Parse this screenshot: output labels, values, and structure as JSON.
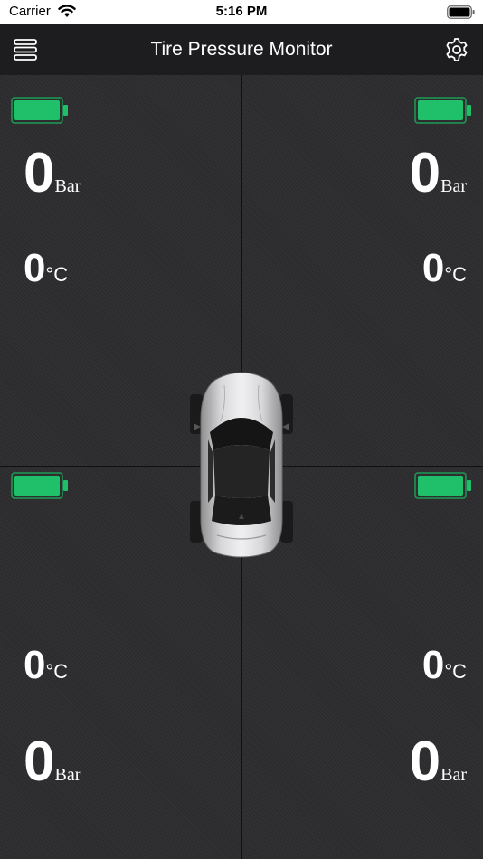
{
  "status_bar": {
    "carrier": "Carrier",
    "time": "5:16 PM"
  },
  "nav": {
    "title": "Tire Pressure Monitor",
    "menu_icon": "menu-icon",
    "settings_icon": "gear-icon"
  },
  "colors": {
    "battery_fill": "#20c06a",
    "battery_outline": "#1d9b57",
    "nav_bg": "#1d1d1f",
    "panel_bg": "#2c2c2e",
    "text": "#ffffff"
  },
  "tires": {
    "front_left": {
      "pressure": "0",
      "pressure_unit": "Bar",
      "temperature": "0",
      "temperature_unit": "°C",
      "battery_level": 1.0
    },
    "front_right": {
      "pressure": "0",
      "pressure_unit": "Bar",
      "temperature": "0",
      "temperature_unit": "°C",
      "battery_level": 1.0
    },
    "rear_left": {
      "pressure": "0",
      "pressure_unit": "Bar",
      "temperature": "0",
      "temperature_unit": "°C",
      "battery_level": 1.0
    },
    "rear_right": {
      "pressure": "0",
      "pressure_unit": "Bar",
      "temperature": "0",
      "temperature_unit": "°C",
      "battery_level": 1.0
    }
  }
}
